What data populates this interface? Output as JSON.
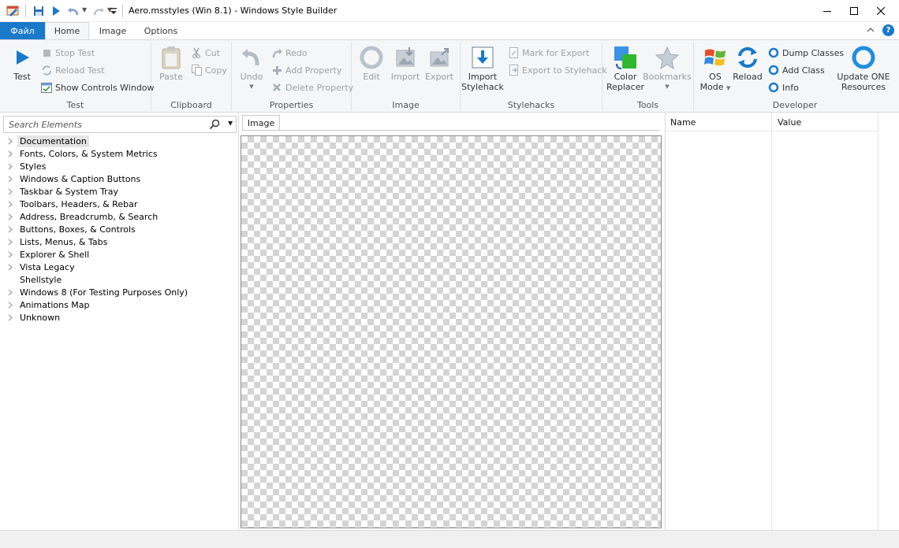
{
  "window": {
    "title": "Aero.msstyles (Win 8.1) - Windows Style Builder"
  },
  "quick_access": {
    "icons": [
      "save-icon",
      "play-icon",
      "undo-icon",
      "redo-icon",
      "customize-icon"
    ]
  },
  "tabs": {
    "file": "Файл",
    "home": "Home",
    "image": "Image",
    "options": "Options"
  },
  "ribbon": {
    "test_group": {
      "label": "Test",
      "test": "Test",
      "stop_test": "Stop Test",
      "reload_test": "Reload Test",
      "show_controls": "Show Controls Window"
    },
    "clipboard_group": {
      "label": "Clipboard",
      "paste": "Paste",
      "cut": "Cut",
      "copy": "Copy"
    },
    "properties_group": {
      "label": "Properties",
      "undo": "Undo",
      "redo": "Redo",
      "add_property": "Add Property",
      "delete_property": "Delete Property"
    },
    "image_group": {
      "label": "Image",
      "edit": "Edit",
      "import": "Import",
      "export": "Export"
    },
    "stylehacks_group": {
      "label": "Stylehacks",
      "import_stylehack_1": "Import",
      "import_stylehack_2": "Stylehack",
      "mark_for_export": "Mark for Export",
      "export_to_stylehack": "Export to Stylehack"
    },
    "tools_group": {
      "label": "Tools",
      "color_replacer_1": "Color",
      "color_replacer_2": "Replacer",
      "bookmarks": "Bookmarks"
    },
    "developer_group": {
      "label": "Developer",
      "os_mode_1": "OS",
      "os_mode_2": "Mode",
      "reload": "Reload",
      "dump_classes": "Dump Classes",
      "add_class": "Add Class",
      "info": "Info",
      "update_one_1": "Update ONE",
      "update_one_2": "Resources"
    }
  },
  "search": {
    "placeholder": "Search Elements"
  },
  "tree": [
    {
      "label": "Documentation",
      "expandable": true,
      "selected": true
    },
    {
      "label": "Fonts, Colors, & System Metrics",
      "expandable": true
    },
    {
      "label": "Styles",
      "expandable": true
    },
    {
      "label": "Windows & Caption Buttons",
      "expandable": true
    },
    {
      "label": "Taskbar & System Tray",
      "expandable": true
    },
    {
      "label": "Toolbars, Headers, & Rebar",
      "expandable": true
    },
    {
      "label": "Address, Breadcrumb, & Search",
      "expandable": true
    },
    {
      "label": "Buttons, Boxes, & Controls",
      "expandable": true
    },
    {
      "label": "Lists, Menus, & Tabs",
      "expandable": true
    },
    {
      "label": "Explorer & Shell",
      "expandable": true
    },
    {
      "label": "Vista Legacy",
      "expandable": true
    },
    {
      "label": "Shellstyle",
      "expandable": false
    },
    {
      "label": "Windows 8 (For Testing Purposes Only)",
      "expandable": true
    },
    {
      "label": "Animations Map",
      "expandable": true
    },
    {
      "label": "Unknown",
      "expandable": true
    }
  ],
  "image_panel": {
    "tab": "Image"
  },
  "properties_panel": {
    "name_header": "Name",
    "value_header": "Value"
  },
  "colors": {
    "accent": "#1979ca",
    "ribbon_bg": "#f5f6f7"
  }
}
